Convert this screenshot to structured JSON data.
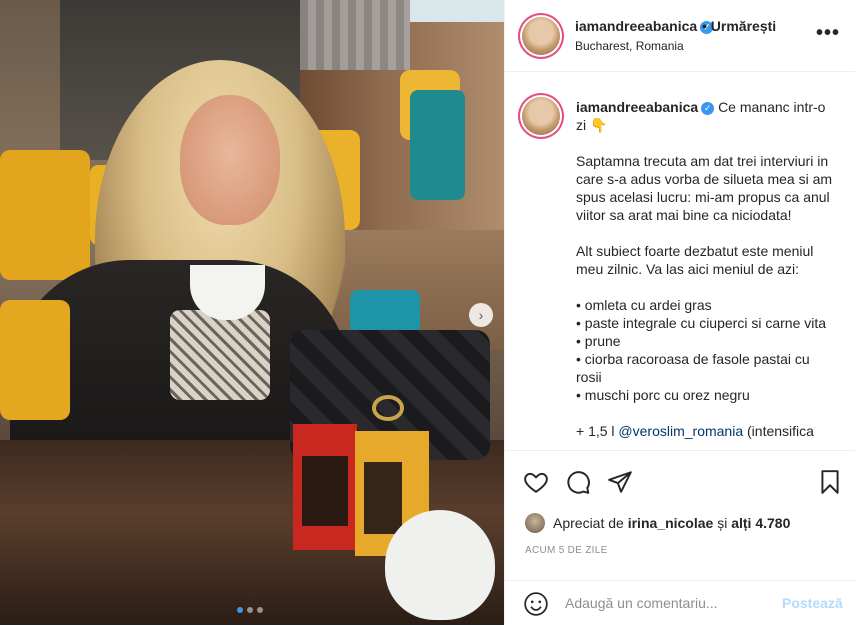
{
  "header": {
    "username": "iamandreeabanica",
    "separator": "•",
    "follow_label": "Urmărești",
    "location": "Bucharest, Romania",
    "more_icon": "more-horizontal-icon"
  },
  "caption": {
    "username": "iamandreeabanica",
    "title": "Ce mananc intr-o zi",
    "title_emoji": "👇",
    "paragraph1": "Saptamna trecuta am dat trei interviuri in care s-a adus vorba de silueta mea si am spus acelasi lucru: mi-am propus ca anul viitor sa arat mai bine ca niciodata!",
    "paragraph2": "Alt subiect foarte dezbatut este meniul meu zilnic. Va las aici meniul de azi:",
    "menu": [
      "• omleta cu ardei gras",
      "• paste integrale cu ciuperci si carne vita",
      "• prune",
      "• ciorba racoroasa de fasole pastai cu rosii",
      "• muschi porc cu orez negru"
    ],
    "extra_prefix": "+ 1,5 l",
    "extra_mention": "@veroslim_romania",
    "extra_suffix": "(intensifica"
  },
  "actions": {
    "icons": [
      "heart-icon",
      "comment-icon",
      "share-icon",
      "bookmark-icon"
    ],
    "likes_prefix": "Apreciat de",
    "likes_user": "irina_nicolae",
    "likes_middle": "și",
    "likes_others": "alți 4.780",
    "timestamp": "ACUM 5 DE ZILE"
  },
  "comment": {
    "placeholder": "Adaugă un comentariu...",
    "post_label": "Postează"
  },
  "carousel": {
    "next_glyph": "›",
    "slide_count": 3,
    "active_index": 0
  },
  "colors": {
    "verified": "#3897f0",
    "link": "#00376b",
    "post_disabled": "#b3dbff",
    "muted": "#8e8e8e"
  }
}
